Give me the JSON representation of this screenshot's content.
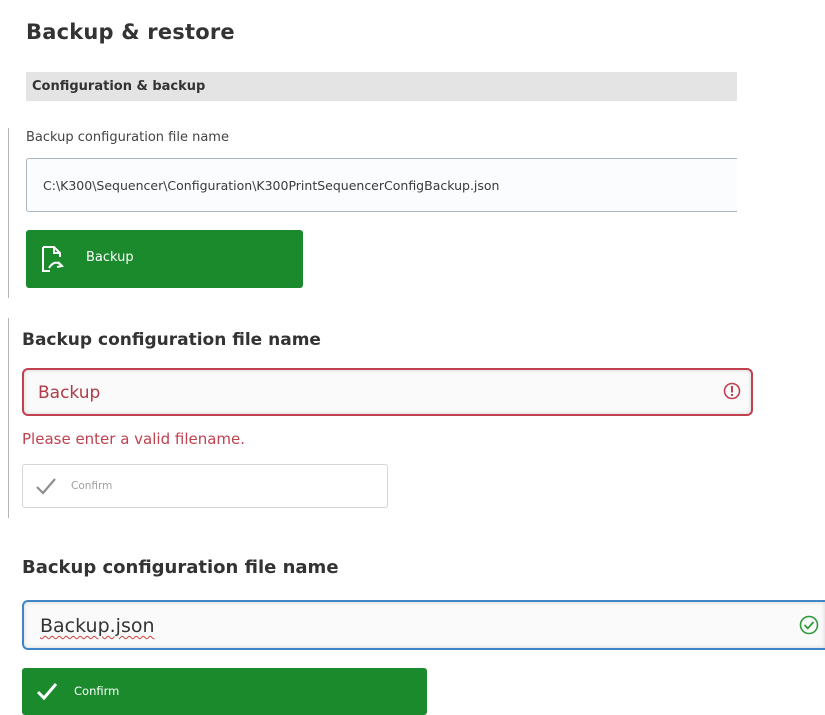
{
  "panel1": {
    "title": "Backup & restore",
    "section_title": "Configuration & backup",
    "field_label": "Backup configuration file name",
    "field_value": "C:\\K300\\Sequencer\\Configuration\\K300PrintSequencerConfigBackup.json",
    "backup_button_label": "Backup",
    "backup_icon": "file-backup-icon",
    "accent": "#1a8a2c"
  },
  "panel2": {
    "field_label": "Backup configuration file name",
    "field_value": "Backup",
    "error_message": "Please enter a valid filename.",
    "error_icon": "alert-circle-icon",
    "confirm_label": "Confirm",
    "confirm_state": "disabled",
    "error_color": "#c0414f"
  },
  "panel3": {
    "field_label": "Backup configuration file name",
    "field_value": "Backup.json",
    "valid_icon": "check-circle-icon",
    "confirm_label": "Confirm",
    "confirm_state": "enabled",
    "focus_color": "#3f86c6",
    "valid_color": "#2e9b3c"
  }
}
